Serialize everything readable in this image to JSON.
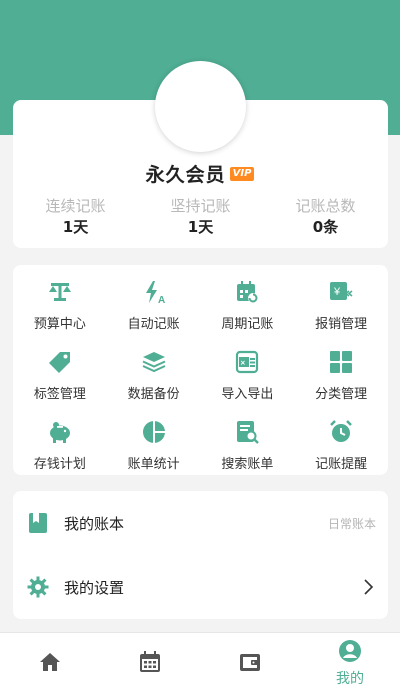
{
  "profile": {
    "member_title": "永久会员",
    "vip_badge": "VIP",
    "stats": [
      {
        "label": "连续记账",
        "value": "1天"
      },
      {
        "label": "坚持记账",
        "value": "1天"
      },
      {
        "label": "记账总数",
        "value": "0条"
      }
    ]
  },
  "features": [
    {
      "label": "预算中心",
      "icon": "scale-icon"
    },
    {
      "label": "自动记账",
      "icon": "auto-bolt-icon"
    },
    {
      "label": "周期记账",
      "icon": "calendar-cycle-icon"
    },
    {
      "label": "报销管理",
      "icon": "reimburse-icon"
    },
    {
      "label": "标签管理",
      "icon": "tag-icon"
    },
    {
      "label": "数据备份",
      "icon": "layers-icon"
    },
    {
      "label": "导入导出",
      "icon": "excel-icon"
    },
    {
      "label": "分类管理",
      "icon": "grid-icon"
    },
    {
      "label": "存钱计划",
      "icon": "piggy-bank-icon"
    },
    {
      "label": "账单统计",
      "icon": "pie-chart-icon"
    },
    {
      "label": "搜索账单",
      "icon": "search-document-icon"
    },
    {
      "label": "记账提醒",
      "icon": "alarm-clock-icon"
    }
  ],
  "list": {
    "my_book": {
      "label": "我的账本",
      "value": "日常账本"
    },
    "my_settings": {
      "label": "我的设置"
    }
  },
  "tabbar": {
    "active_label": "我的"
  },
  "colors": {
    "accent": "#4fae94",
    "vip": "#ff8a1f"
  }
}
